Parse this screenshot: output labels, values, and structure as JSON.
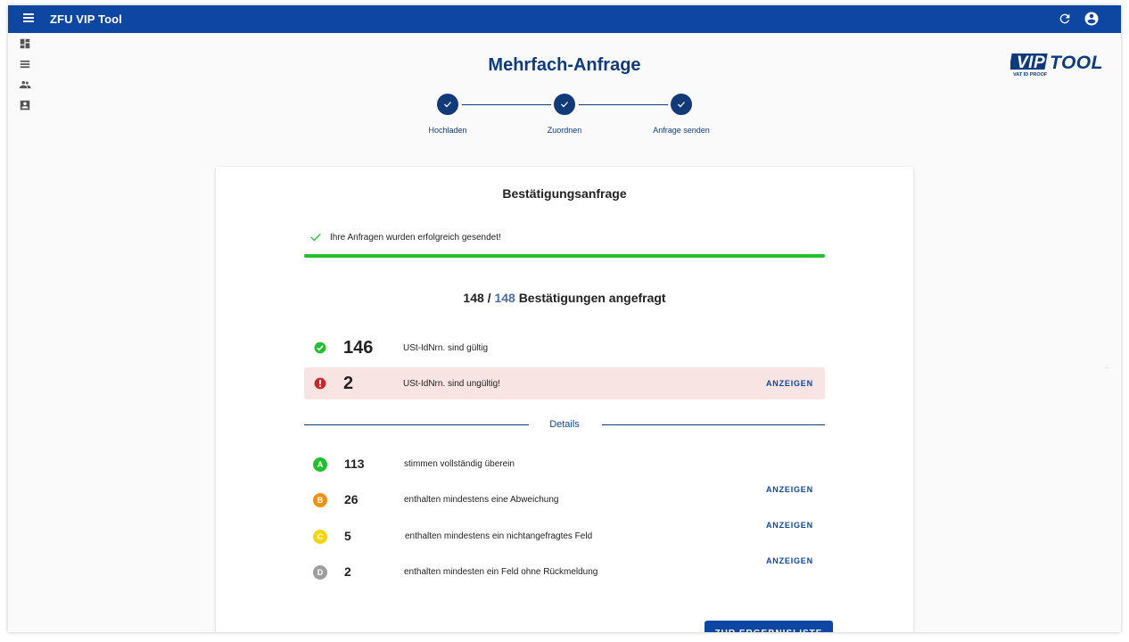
{
  "app": {
    "title": "ZFU VIP Tool"
  },
  "logo": {
    "text": "VIPTOOL",
    "tagline": "VAT ID PROOF"
  },
  "page": {
    "title": "Mehrfach-Anfrage"
  },
  "stepper": {
    "steps": [
      {
        "label": "Hochladen",
        "state": "done"
      },
      {
        "label": "Zuordnen",
        "state": "done"
      },
      {
        "label": "Anfrage senden",
        "state": "done"
      }
    ]
  },
  "card": {
    "title": "Bestätigungsanfrage",
    "success_message": "Ihre Anfragen wurden erfolgreich gesendet!",
    "progress_percent": 100,
    "counts": {
      "done": "148",
      "separator": "/",
      "total": "148",
      "label": "Bestätigungen angefragt"
    },
    "summary": [
      {
        "count": "146",
        "label": "USt-IdNrn. sind gültig",
        "status": "valid"
      },
      {
        "count": "2",
        "label": "USt-IdNrn. sind ungültig!",
        "status": "invalid",
        "action": "ANZEIGEN"
      }
    ],
    "details_label": "Details",
    "details": [
      {
        "badge": "A",
        "color": "#22c02c",
        "count": "113",
        "label": "stimmen vollständig überein"
      },
      {
        "badge": "B",
        "color": "#f0920f",
        "count": "26",
        "label": "enthalten mindestens eine Abweichung",
        "action": "ANZEIGEN"
      },
      {
        "badge": "C",
        "color": "#f5d50f",
        "count": "5",
        "label": "enthalten mindestens ein nichtangefragtes Feld",
        "action": "ANZEIGEN"
      },
      {
        "badge": "D",
        "color": "#9e9e9e",
        "count": "2",
        "label": "enthalten mindesten ein Feld ohne Rückmeldung",
        "action": "ANZEIGEN"
      }
    ],
    "result_button": "ZUR ERGEBNISLISTE"
  },
  "colors": {
    "primary": "#0d47a1",
    "valid": "#22c02c",
    "invalid": "#c62828",
    "invalid_bg": "#f8e4e2"
  }
}
